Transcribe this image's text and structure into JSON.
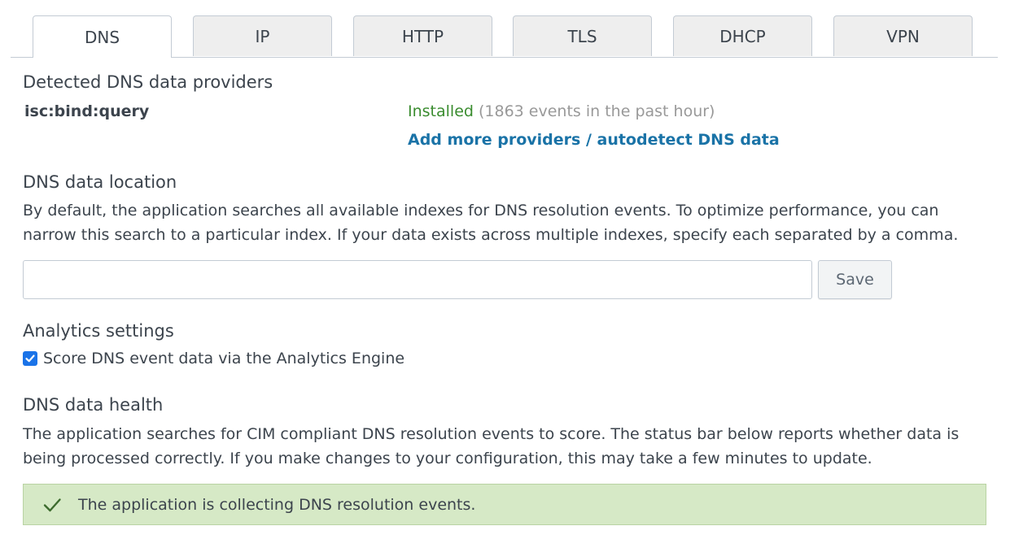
{
  "tabs": [
    {
      "label": "DNS",
      "active": true
    },
    {
      "label": "IP",
      "active": false
    },
    {
      "label": "HTTP",
      "active": false
    },
    {
      "label": "TLS",
      "active": false
    },
    {
      "label": "DHCP",
      "active": false
    },
    {
      "label": "VPN",
      "active": false
    }
  ],
  "providers": {
    "title": "Detected DNS data providers",
    "items": [
      {
        "name": "isc:bind:query",
        "status": "Installed",
        "detail": "(1863 events in the past hour)"
      }
    ],
    "add_link": "Add more providers / autodetect DNS data"
  },
  "location": {
    "title": "DNS data location",
    "description": "By default, the application searches all available indexes for DNS resolution events. To optimize performance, you can narrow this search to a particular index. If your data exists across multiple indexes, specify each separated by a comma.",
    "input_value": "",
    "save_label": "Save"
  },
  "analytics": {
    "title": "Analytics settings",
    "checkbox_label": "Score DNS event data via the Analytics Engine",
    "checked": true
  },
  "health": {
    "title": "DNS data health",
    "description": "The application searches for CIM compliant DNS resolution events to score. The status bar below reports whether data is being processed correctly. If you make changes to your configuration, this may take a few minutes to update.",
    "status_message": "The application is collecting DNS resolution events.",
    "status_icon": "checkmark-icon"
  },
  "colors": {
    "installed": "#3a8c2f",
    "link": "#1a73a7",
    "success_bg": "#d6e9c6",
    "checkbox": "#1a73e8"
  }
}
